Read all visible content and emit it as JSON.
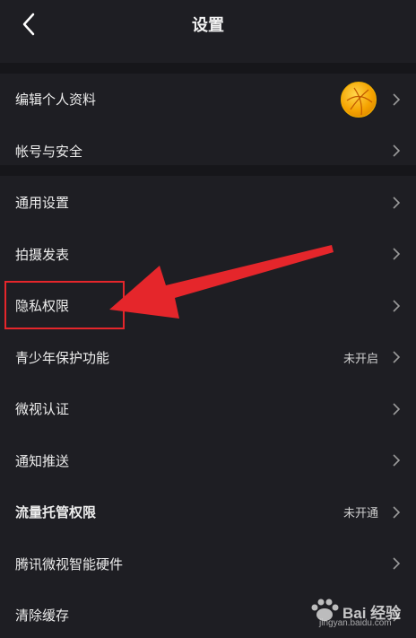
{
  "header": {
    "title": "设置"
  },
  "group1": [
    {
      "label": "编辑个人资料",
      "has_avatar": true
    },
    {
      "label": "帐号与安全"
    }
  ],
  "group2": [
    {
      "label": "通用设置"
    },
    {
      "label": "拍摄发表"
    },
    {
      "label": "隐私权限"
    },
    {
      "label": "青少年保护功能",
      "status": "未开启"
    },
    {
      "label": "微视认证"
    },
    {
      "label": "通知推送"
    },
    {
      "label": "流量托管权限",
      "status": "未开通"
    },
    {
      "label": "腾讯微视智能硬件"
    },
    {
      "label": "清除缓存"
    }
  ],
  "watermark": {
    "text": "Bai 经验",
    "sub": "jingyan.baidu.com"
  },
  "colors": {
    "background": "#1e1e23",
    "separator": "#16161a",
    "annotation_red": "#e5262b"
  }
}
